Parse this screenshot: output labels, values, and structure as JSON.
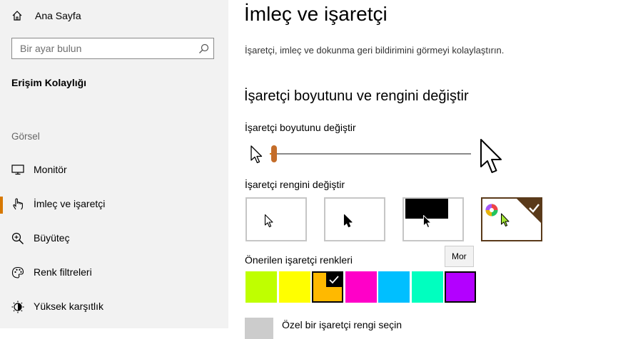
{
  "sidebar": {
    "home_label": "Ana Sayfa",
    "search_placeholder": "Bir ayar bulun",
    "section_title": "Erişim Kolaylığı",
    "group_label": "Görsel",
    "items": [
      {
        "label": "Monitör",
        "icon": "monitor-icon",
        "active": false
      },
      {
        "label": "İmleç ve işaretçi",
        "icon": "pointer-hand-icon",
        "active": true
      },
      {
        "label": "Büyüteç",
        "icon": "magnifier-icon",
        "active": false
      },
      {
        "label": "Renk filtreleri",
        "icon": "palette-icon",
        "active": false
      },
      {
        "label": "Yüksek karşıtlık",
        "icon": "high-contrast-icon",
        "active": false
      }
    ]
  },
  "main": {
    "title": "İmleç ve işaretçi",
    "description": "İşaretçi, imleç ve dokunma geri bildirimini görmeyi kolaylaştırın.",
    "subtitle": "İşaretçi boyutunu ve rengini değiştir",
    "size_label": "İşaretçi boyutunu değiştir",
    "size_value": 1,
    "size_max": 15,
    "color_label": "İşaretçi rengini değiştir",
    "color_options": [
      "white",
      "black",
      "inverted",
      "custom"
    ],
    "selected_color_option": "custom",
    "tooltip": "Mor",
    "suggested_label": "Önerilen işaretçi renkleri",
    "suggested_colors": [
      "#bfff00",
      "#ffff00",
      "#ffb900",
      "#ff00c8",
      "#00bfff",
      "#00ffbf",
      "#b300ff"
    ],
    "selected_suggested_index": 2,
    "custom_label": "Özel bir işaretçi rengi seçin"
  },
  "colors": {
    "accent": "#d77800",
    "sidebar_bg": "#f2f2f2"
  }
}
